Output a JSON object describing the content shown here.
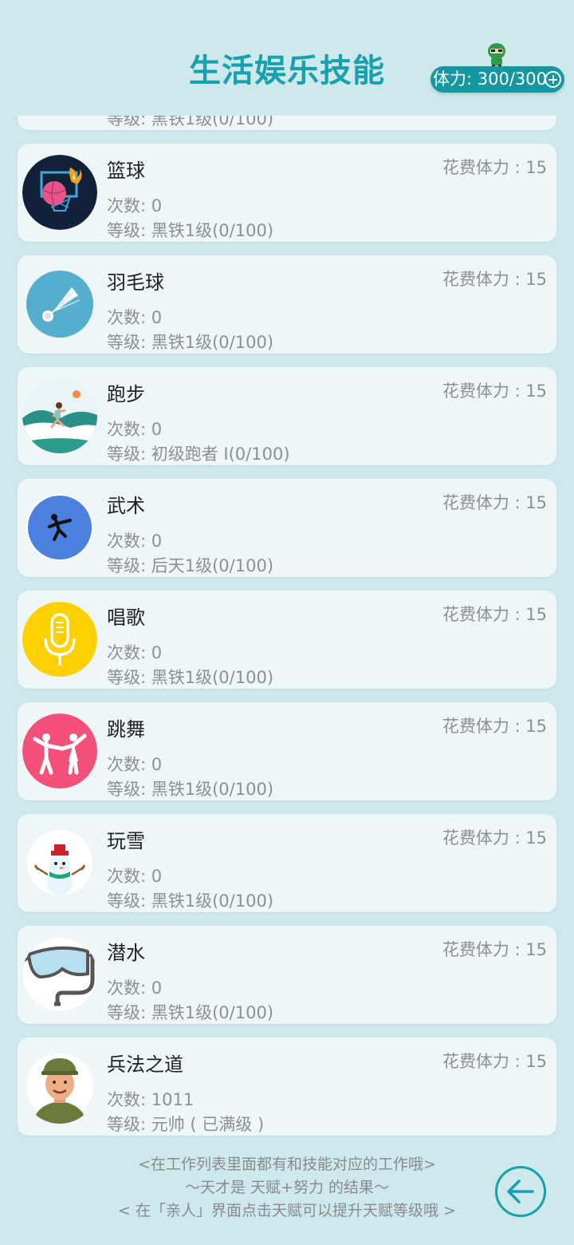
{
  "header": {
    "title": "生活娱乐技能",
    "stamina_label": "体力: 300/300"
  },
  "partial_card": {
    "level": "等级: 黑铁1级(0/100)"
  },
  "skills": [
    {
      "name": "篮球",
      "cost": "花费体力 : 15",
      "count": "次数: 0",
      "level": "等级: 黑铁1级(0/100)",
      "icon": "basketball-icon"
    },
    {
      "name": "羽毛球",
      "cost": "花费体力 : 15",
      "count": "次数: 0",
      "level": "等级: 黑铁1级(0/100)",
      "icon": "badminton-icon"
    },
    {
      "name": "跑步",
      "cost": "花费体力 : 15",
      "count": "次数: 0",
      "level": "等级: 初级跑者 I(0/100)",
      "icon": "running-icon"
    },
    {
      "name": "武术",
      "cost": "花费体力 : 15",
      "count": "次数: 0",
      "level": "等级: 后天1级(0/100)",
      "icon": "martial-arts-icon"
    },
    {
      "name": "唱歌",
      "cost": "花费体力 : 15",
      "count": "次数: 0",
      "level": "等级: 黑铁1级(0/100)",
      "icon": "microphone-icon"
    },
    {
      "name": "跳舞",
      "cost": "花费体力 : 15",
      "count": "次数: 0",
      "level": "等级: 黑铁1级(0/100)",
      "icon": "dance-icon"
    },
    {
      "name": "玩雪",
      "cost": "花费体力 : 15",
      "count": "次数: 0",
      "level": "等级: 黑铁1级(0/100)",
      "icon": "snowman-icon"
    },
    {
      "name": "潜水",
      "cost": "花费体力 : 15",
      "count": "次数: 0",
      "level": "等级: 黑铁1级(0/100)",
      "icon": "diving-mask-icon"
    },
    {
      "name": "兵法之道",
      "cost": "花费体力 : 15",
      "count": "次数: 1011",
      "level": "等级: 元帅 ( 已满级 )",
      "icon": "soldier-icon"
    }
  ],
  "footer": {
    "tip1": "<在工作列表里面都有和技能对应的工作哦>",
    "tip2": "～天才是 天赋+努力 的结果～",
    "tip3": "< 在「亲人」界面点击天赋可以提升天赋等级哦 >"
  },
  "colors": {
    "background": "#cde9ec",
    "accent": "#17a0ad",
    "card": "#eef6f7",
    "basketball_bg": "#12213a",
    "badminton_bg": "#55aecd",
    "martial_bg": "#4b7fe0",
    "sing_bg": "#ffd000",
    "dance_bg": "#f5507a"
  }
}
